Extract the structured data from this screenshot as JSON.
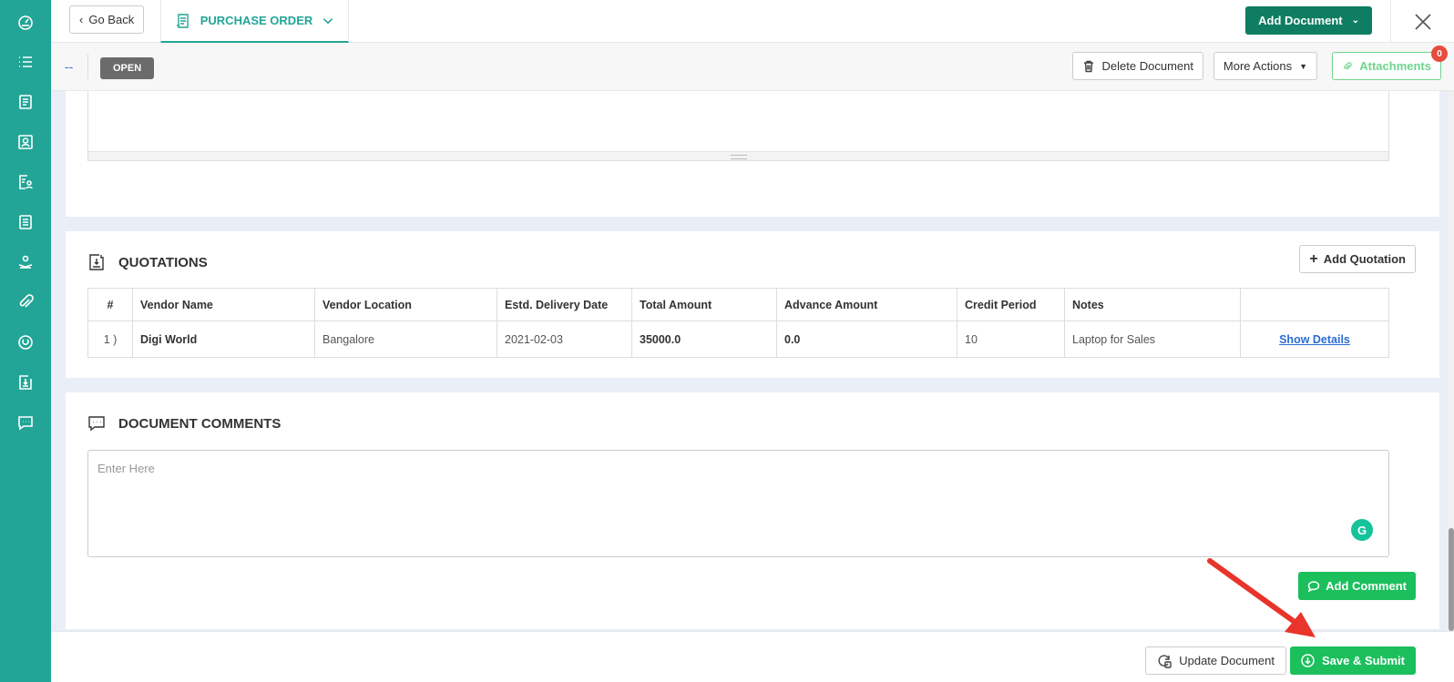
{
  "sidebar": {
    "items": [
      {
        "icon": "dashboard-icon"
      },
      {
        "icon": "list-icon"
      },
      {
        "icon": "document-list-icon"
      },
      {
        "icon": "contact-card-icon"
      },
      {
        "icon": "user-document-icon"
      },
      {
        "icon": "form-icon"
      },
      {
        "icon": "hand-user-icon"
      },
      {
        "icon": "paperclip-icon"
      },
      {
        "icon": "circle-refresh-icon"
      },
      {
        "icon": "quotation-icon"
      },
      {
        "icon": "chat-icon"
      }
    ]
  },
  "topbar": {
    "go_back": "Go Back",
    "tab": "PURCHASE ORDER",
    "add_document": "Add Document"
  },
  "subbar": {
    "dash": "--",
    "status": "OPEN",
    "delete_document": "Delete Document",
    "more_actions": "More Actions",
    "attachments": "Attachments",
    "attachments_count": "0"
  },
  "quotations": {
    "title": "QUOTATIONS",
    "add_button": "Add Quotation",
    "columns": [
      "#",
      "Vendor Name",
      "Vendor Location",
      "Estd. Delivery Date",
      "Total Amount",
      "Advance Amount",
      "Credit Period",
      "Notes",
      ""
    ],
    "rows": [
      {
        "index": "1 )",
        "vendor_name": "Digi World",
        "vendor_location": "Bangalore",
        "delivery_date": "2021-02-03",
        "total_amount": "35000.0",
        "advance_amount": "0.0",
        "credit_period": "10",
        "notes": "Laptop for Sales",
        "action": "Show Details"
      }
    ]
  },
  "comments": {
    "title": "DOCUMENT COMMENTS",
    "placeholder": "Enter Here",
    "add_button": "Add Comment"
  },
  "bottombar": {
    "update_document": "Update Document",
    "save_submit": "Save & Submit"
  },
  "colors": {
    "sidebar": "#22a596",
    "primary_dark": "#0f7d62",
    "success": "#1bbf5c",
    "link": "#2b6ed0",
    "annotation_arrow": "#e8342a"
  }
}
